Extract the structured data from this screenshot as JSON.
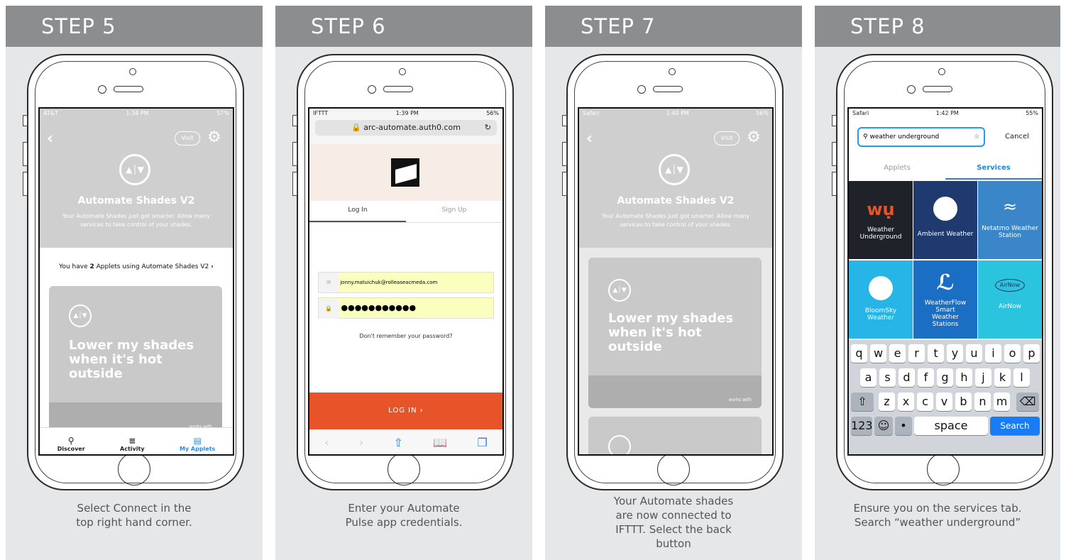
{
  "steps": [
    {
      "title": "STEP 5",
      "caption": [
        "Select Connect in the",
        "top right hand corner."
      ]
    },
    {
      "title": "STEP 6",
      "caption": [
        "Enter your Automate",
        "Pulse app credentials."
      ]
    },
    {
      "title": "STEP 7",
      "caption": [
        "Your Automate shades",
        "are now connected to",
        "IFTTT. Select the back",
        "button"
      ]
    },
    {
      "title": "STEP 8",
      "caption": [
        "Ensure you on the services tab.",
        "Search “weather underground”"
      ]
    }
  ],
  "s5": {
    "status_left": "AT&T",
    "time": "1:34 PM",
    "battery": "57%",
    "visit": "Visit",
    "app_name": "Automate Shades V2",
    "desc": "Your Automate Shades just got smarter. Allow many services to take control of your shades.",
    "applets_prefix": "You have ",
    "applets_count": "2",
    "applets_suffix": " Applets using Automate Shades V2",
    "card_title": "Lower my shades when it's hot outside",
    "works_with": "works with",
    "tabs": [
      "Discover",
      "Activity",
      "My Applets"
    ]
  },
  "s6": {
    "status_left": "IFTTT",
    "time": "1:39 PM",
    "battery": "56%",
    "url": "arc-automate.auth0.com",
    "tab_login": "Log In",
    "tab_signup": "Sign Up",
    "email": "jonny.matuichuk@rolleaseacmeda.com",
    "password": "●●●●●●●●●●●",
    "forgot": "Don't remember your password?",
    "login_btn": "LOG IN"
  },
  "s7": {
    "status_left": "Safari",
    "time": "1:40 PM",
    "battery": "56%",
    "visit": "Visit",
    "app_name": "Automate Shades V2",
    "desc": "Your Automate Shades just got smarter. Allow many services to take control of your shades.",
    "card_title": "Lower my shades when it's hot outside",
    "works_with": "works with"
  },
  "s8": {
    "status_left": "Safari",
    "time": "1:42 PM",
    "battery": "55%",
    "search_value": "weather underground",
    "cancel": "Cancel",
    "tab_applets": "Applets",
    "tab_services": "Services",
    "services": [
      {
        "name": "Weather Underground",
        "color": "#1f2329"
      },
      {
        "name": "Ambient Weather",
        "color": "#1e3a6e"
      },
      {
        "name": "Netatmo Weather Station",
        "color": "#3a86c8"
      },
      {
        "name": "BloomSky Weather",
        "color": "#27b5e8"
      },
      {
        "name": "WeatherFlow Smart Weather Stations",
        "color": "#1a6fc4"
      },
      {
        "name": "AirNow",
        "color": "#2bc4de"
      }
    ],
    "keys_row1": [
      "q",
      "w",
      "e",
      "r",
      "t",
      "y",
      "u",
      "i",
      "o",
      "p"
    ],
    "keys_row2": [
      "a",
      "s",
      "d",
      "f",
      "g",
      "h",
      "j",
      "k",
      "l"
    ],
    "keys_row3": [
      "z",
      "x",
      "c",
      "v",
      "b",
      "n",
      "m"
    ],
    "key_123": "123",
    "key_space": "space",
    "key_search": "Search"
  },
  "colors": {
    "header": "#8c8d8f",
    "ifttt_gray": "#cfcfcf",
    "login_orange": "#e8542a",
    "services_blue": "#1a8ad8"
  }
}
